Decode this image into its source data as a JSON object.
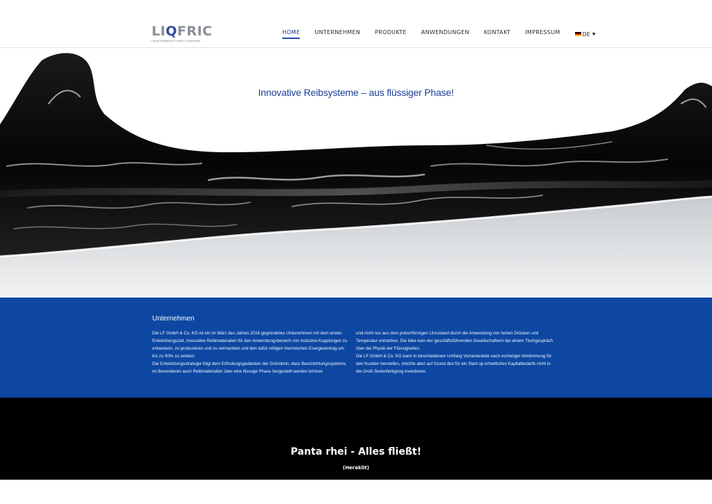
{
  "header": {
    "logo": {
      "prefix": "LI",
      "accent": "Q",
      "suffix": "FRIC",
      "tagline": "Liquid Intelligence Friction Components"
    },
    "nav": [
      {
        "label": "HOME",
        "active": true
      },
      {
        "label": "UNTERNEHMEN",
        "active": false
      },
      {
        "label": "PRODUKTE",
        "active": false
      },
      {
        "label": "ANWENDUNGEN",
        "active": false
      },
      {
        "label": "KONTAKT",
        "active": false
      },
      {
        "label": "IMPRESSUM",
        "active": false
      }
    ],
    "language": {
      "label": "DE",
      "icon": "german-flag-icon",
      "flag_colors": [
        "#000000",
        "#dd0000",
        "#ffce00"
      ]
    }
  },
  "hero": {
    "title": "Innovative Reibsysteme – aus flüssiger Phase!",
    "image": "black-liquid-splash"
  },
  "company": {
    "heading": "Unternehmen",
    "left_paragraphs": [
      "Die LF GmbH & Co. KG ist ein im März des Jahres 2016 gegründetes Unternehmen mit dem ersten Entwicklungsziel, innovative Reibmaterialien für den Anwendungsbereich von Industrie-Kupplungen zu entwickeln, zu produzieren und zu vermarkten und den dafür nötigen thermischen Energieeintrag um bis zu 90% zu senken.",
      "Die Entwicklungsstrategie folgt dem Erfindungsgedanken der Gründerin, dass Beschichtungssysteme, im Besonderen auch Reibmaterialien über eine flüssige Phase hergestellt werden können"
    ],
    "right_paragraphs": [
      "und nicht nur aus dem pulverförmigen Urzustand durch die Anwendung von hohen Drücken und Temperatur entstehen. Die Idee kam der geschäftsführenden Gesellschafterin bei einem Tischgespräch über die Physik der Flüssigkeiten.",
      "Die LF GmbH & Co. KG kann in bescheidenem Umfang Vorserienteile nach vorheriger Abstimmung für den Kunden herstellen, möchte aber auf Grund des für ein Start-up erheblichen Kapitalbedarfs nicht in die Groß-Serienfertigung investieren."
    ],
    "background": "#0d47a1"
  },
  "quote": {
    "text": "Panta rhei - Alles fließt!",
    "author": "(Heraklit)"
  }
}
